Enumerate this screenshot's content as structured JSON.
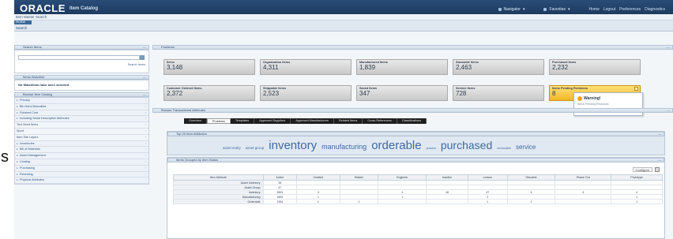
{
  "outer_glyph": "s",
  "header": {
    "logo": "ORACLE",
    "app_title": "Item Catalog",
    "menu_navigator": "Navigator",
    "menu_favorites": "Favorites",
    "links": [
      "Home",
      "Logout",
      "Preferences",
      "Diagnostics"
    ]
  },
  "tabs": {
    "home": "Home",
    "search": "Search"
  },
  "breadcrumb": "Item Master Search",
  "sidebar": {
    "search_title": "Search Items",
    "search_link": "Search Items",
    "watchlist_title": "Items Watchlist",
    "watchlist_empty": "No Watchlists have been selected.",
    "browse_title": "Browse Item Catalog",
    "nav_items": [
      {
        "label": "Primary",
        "type": "node"
      },
      {
        "label": "Bin Hand Navcatlas",
        "type": "node"
      },
      {
        "label": "Finished Cost",
        "type": "node"
      },
      {
        "label": "Including Serial Descriptive Attributes",
        "type": "node"
      },
      {
        "label": "Tool Seed Items",
        "type": "plain"
      },
      {
        "label": "Sport",
        "type": "plain"
      },
      {
        "label": "Item Site Layers",
        "type": "plain"
      },
      {
        "label": "Inventories",
        "type": "node"
      },
      {
        "label": "Bill of Materials",
        "type": "node"
      },
      {
        "label": "Asset Management",
        "type": "node"
      },
      {
        "label": "Costing",
        "type": "node"
      },
      {
        "label": "Purchasing",
        "type": "node"
      },
      {
        "label": "Receiving",
        "type": "node"
      },
      {
        "label": "Physical Attributes",
        "type": "node"
      }
    ]
  },
  "problems_title": "Problems",
  "tiles": [
    {
      "label": "Items",
      "value": "3,148",
      "warn": false
    },
    {
      "label": "Organization Items",
      "value": "4,311",
      "warn": false
    },
    {
      "label": "Manufactured Items",
      "value": "1,839",
      "warn": false
    },
    {
      "label": "Stockable Items",
      "value": "2,463",
      "warn": false
    },
    {
      "label": "Purchased Items",
      "value": "2,232",
      "warn": false
    },
    {
      "label": "Customer Ordered Items",
      "value": "2,372",
      "warn": false
    },
    {
      "label": "Shippable Items",
      "value": "2,523",
      "warn": false
    },
    {
      "label": "Saved Items",
      "value": "347",
      "warn": false
    },
    {
      "label": "Service Items",
      "value": "728",
      "warn": false
    },
    {
      "label": "Items Pending Revisions",
      "value": "8",
      "warn": true
    }
  ],
  "popup": {
    "title": "Warning!",
    "text": "Items Pending Revisions"
  },
  "transactional_title": "Browse Transactional Attributes",
  "view_tabs": [
    {
      "label": "Overview",
      "active": false
    },
    {
      "label": "Problems",
      "active": true
    },
    {
      "label": "Templates",
      "active": false
    },
    {
      "label": "Approved Suppliers",
      "active": false
    },
    {
      "label": "Approved Manufacturers",
      "active": false
    },
    {
      "label": "Related Items",
      "active": false
    },
    {
      "label": "Cross References",
      "active": false
    },
    {
      "label": "Classifications",
      "active": false
    }
  ],
  "tagcloud_title": "Top 20 Item Attributes",
  "tags": [
    {
      "text": "asset entity",
      "size": 4.5
    },
    {
      "text": "asset group",
      "size": 4.5
    },
    {
      "text": "inventory",
      "size": 15
    },
    {
      "text": "manufacturing",
      "size": 9
    },
    {
      "text": "orderable",
      "size": 15
    },
    {
      "text": "process",
      "size": 3.5
    },
    {
      "text": "purchased",
      "size": 14
    },
    {
      "text": "serviceable",
      "size": 3.5
    },
    {
      "text": "service",
      "size": 8
    }
  ],
  "table_title": "Items Grouped by Item Status",
  "table_buttons": [
    "Configure"
  ],
  "table": {
    "headers": [
      "Item Attribute",
      "Active",
      "Created",
      "Hidden",
      "Engineer",
      "Inactive",
      "Leaves",
      "Obsolete",
      "Phase Out",
      "Prototype"
    ],
    "rows": [
      [
        "Asset Inventory",
        "35",
        "",
        "",
        "",
        "",
        "",
        "",
        "",
        ""
      ],
      [
        "Asset Group",
        "47",
        "",
        "",
        "",
        "",
        "",
        "",
        "",
        ""
      ],
      [
        "Inventory",
        "2891",
        "4",
        "",
        "4",
        "18",
        "47",
        "4",
        "4",
        "4"
      ],
      [
        "Manufacturing",
        "1899",
        "1",
        "",
        "1",
        "",
        "2",
        "",
        "",
        "1"
      ],
      [
        "Orderable",
        "2354",
        "1",
        "1",
        "",
        "",
        "1",
        "1",
        "",
        "1"
      ]
    ]
  }
}
